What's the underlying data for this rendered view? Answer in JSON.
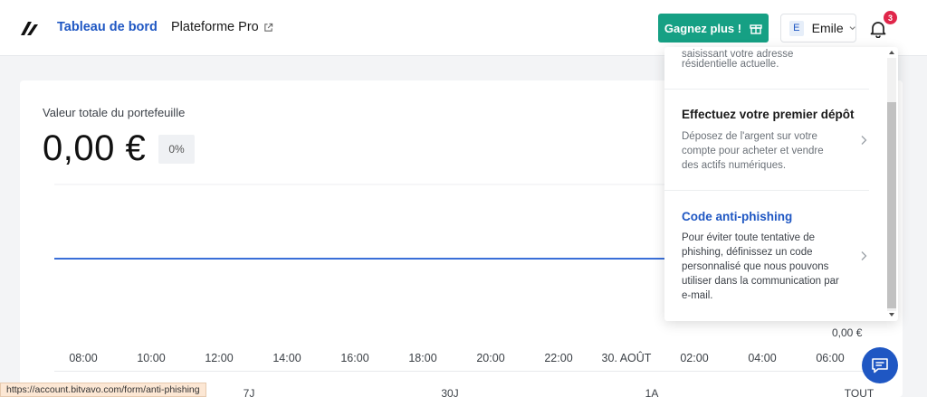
{
  "header": {
    "nav_dashboard": "Tableau de bord",
    "nav_pro": "Plateforme Pro",
    "earn_label": "Gagnez plus !",
    "user_initial": "E",
    "user_name": "Emile",
    "notifications_count": "3"
  },
  "portfolio": {
    "label": "Valeur totale du portefeuille",
    "value": "0,00 €",
    "change": "0%"
  },
  "chart_data": {
    "type": "line",
    "x": [
      "08:00",
      "10:00",
      "12:00",
      "14:00",
      "16:00",
      "18:00",
      "20:00",
      "22:00",
      "30. AOÛT",
      "02:00",
      "04:00",
      "06:00"
    ],
    "series": [
      {
        "values": [
          0,
          0,
          0,
          0,
          0,
          0,
          0,
          0,
          0,
          0,
          0,
          0
        ]
      }
    ],
    "y_tick_label": "0,00 €",
    "title": "",
    "xlabel": "",
    "ylabel": ""
  },
  "ranges": [
    "7J",
    "30J",
    "1A",
    "TOUT"
  ],
  "panel": {
    "item1_text": [
      "saisissant votre adresse",
      "résidentielle actuelle."
    ],
    "item2_title": "Effectuez votre premier dépôt",
    "item2_text": [
      "Déposez de l'argent sur votre",
      "compte pour acheter et vendre",
      "des actifs numériques."
    ],
    "item3_title": "Code anti-phishing",
    "item3_text": [
      "Pour éviter toute tentative de",
      "phishing, définissez un code",
      "personnalisé que nous pouvons",
      "utiliser dans la communication par",
      "e-mail."
    ]
  },
  "status_url": "https://account.bitvavo.com/form/anti-phishing",
  "colors": {
    "brand": "#1f57c3",
    "earn": "#16a084",
    "badge": "#e0264a",
    "line": "#3a6fd8"
  },
  "icons": [
    "brand-logo-icon",
    "external-link-icon",
    "gift-icon",
    "chevron-down-icon",
    "bell-icon",
    "chevron-right-icon",
    "chat-icon"
  ]
}
